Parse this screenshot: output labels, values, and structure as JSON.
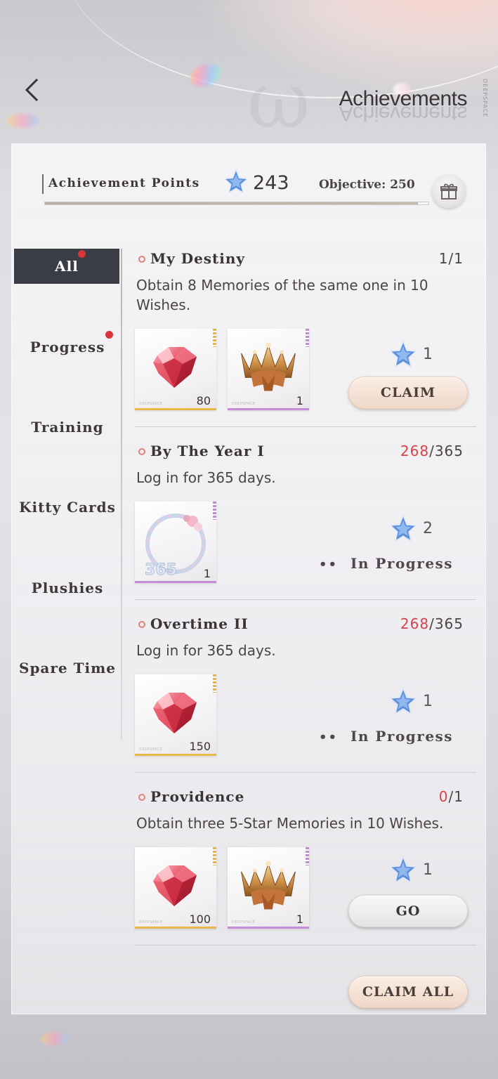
{
  "header": {
    "title": "Achievements",
    "side_mark": "DEEPSPACE"
  },
  "points": {
    "label": "Achievement Points",
    "value": "243",
    "objective": "Objective: 250",
    "progress_fraction": 0.972
  },
  "sidebar": {
    "items": [
      {
        "label": "All",
        "active": true,
        "badge": true
      },
      {
        "label": "Progress",
        "active": false,
        "badge": true
      },
      {
        "label": "Training",
        "active": false,
        "badge": false
      },
      {
        "label": "Kitty Cards",
        "active": false,
        "badge": false
      },
      {
        "label": "Plushies",
        "active": false,
        "badge": false
      },
      {
        "label": "Spare Time",
        "active": false,
        "badge": false
      }
    ]
  },
  "achievements": [
    {
      "title": "My Destiny",
      "progress_current": "1",
      "progress_total": "/1",
      "description": "Obtain 8 Memories of the same one in 10 Wishes.",
      "rewards": [
        {
          "item": "gem-icon",
          "qty": "80"
        },
        {
          "item": "crown-icon",
          "qty": "1"
        }
      ],
      "points": "1",
      "action": "CLAIM"
    },
    {
      "title": "By The Year I",
      "progress_current": "268",
      "progress_total": "/365",
      "description": "Log in for 365 days.",
      "rewards": [
        {
          "item": "frame-icon",
          "qty": "1",
          "label": "365"
        }
      ],
      "points": "2",
      "status": "In Progress"
    },
    {
      "title": "Overtime II",
      "progress_current": "268",
      "progress_total": "/365",
      "description": "Log in for 365 days.",
      "rewards": [
        {
          "item": "gem-icon",
          "qty": "150"
        }
      ],
      "points": "1",
      "status": "In Progress"
    },
    {
      "title": "Providence",
      "progress_current": "0",
      "progress_total": "/1",
      "description": "Obtain three 5-Star Memories in 10 Wishes.",
      "rewards": [
        {
          "item": "gem-icon",
          "qty": "100"
        },
        {
          "item": "crown-icon",
          "qty": "1"
        }
      ],
      "points": "1",
      "action": "GO"
    }
  ],
  "footer": {
    "claim_all": "CLAIM ALL"
  },
  "colors": {
    "accent_red": "#d8424a",
    "active_tab": "#3b3d46",
    "gold_rarity": "#e9b84c",
    "purple_rarity": "#c58bd8"
  }
}
